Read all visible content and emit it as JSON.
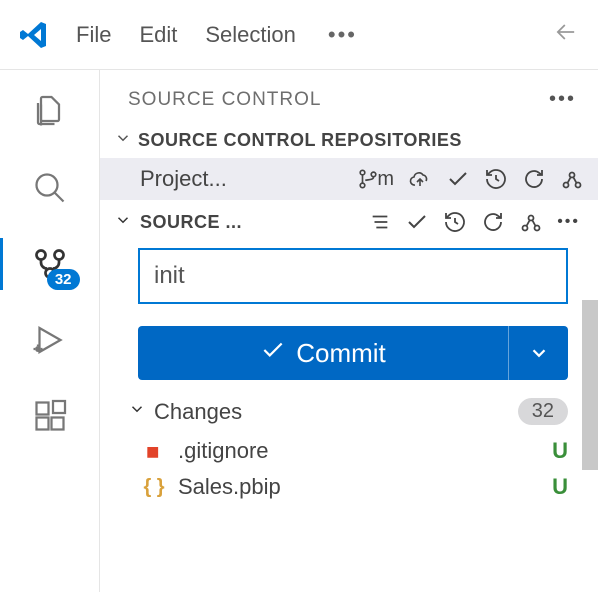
{
  "titlebar": {
    "menu": [
      "File",
      "Edit",
      "Selection"
    ]
  },
  "activitybar": {
    "scm_badge": "32"
  },
  "panel": {
    "title": "SOURCE CONTROL",
    "repositories_section": "SOURCE CONTROL REPOSITORIES",
    "repo_name": "Project...",
    "branch_indicator": "m",
    "source_control_section": "SOURCE ...",
    "commit_message": "init",
    "commit_button": "Commit",
    "changes_label": "Changes",
    "changes_count": "32",
    "files": [
      {
        "name": ".gitignore",
        "status": "U",
        "icon": "gitignore"
      },
      {
        "name": "Sales.pbip",
        "status": "U",
        "icon": "json"
      }
    ]
  }
}
